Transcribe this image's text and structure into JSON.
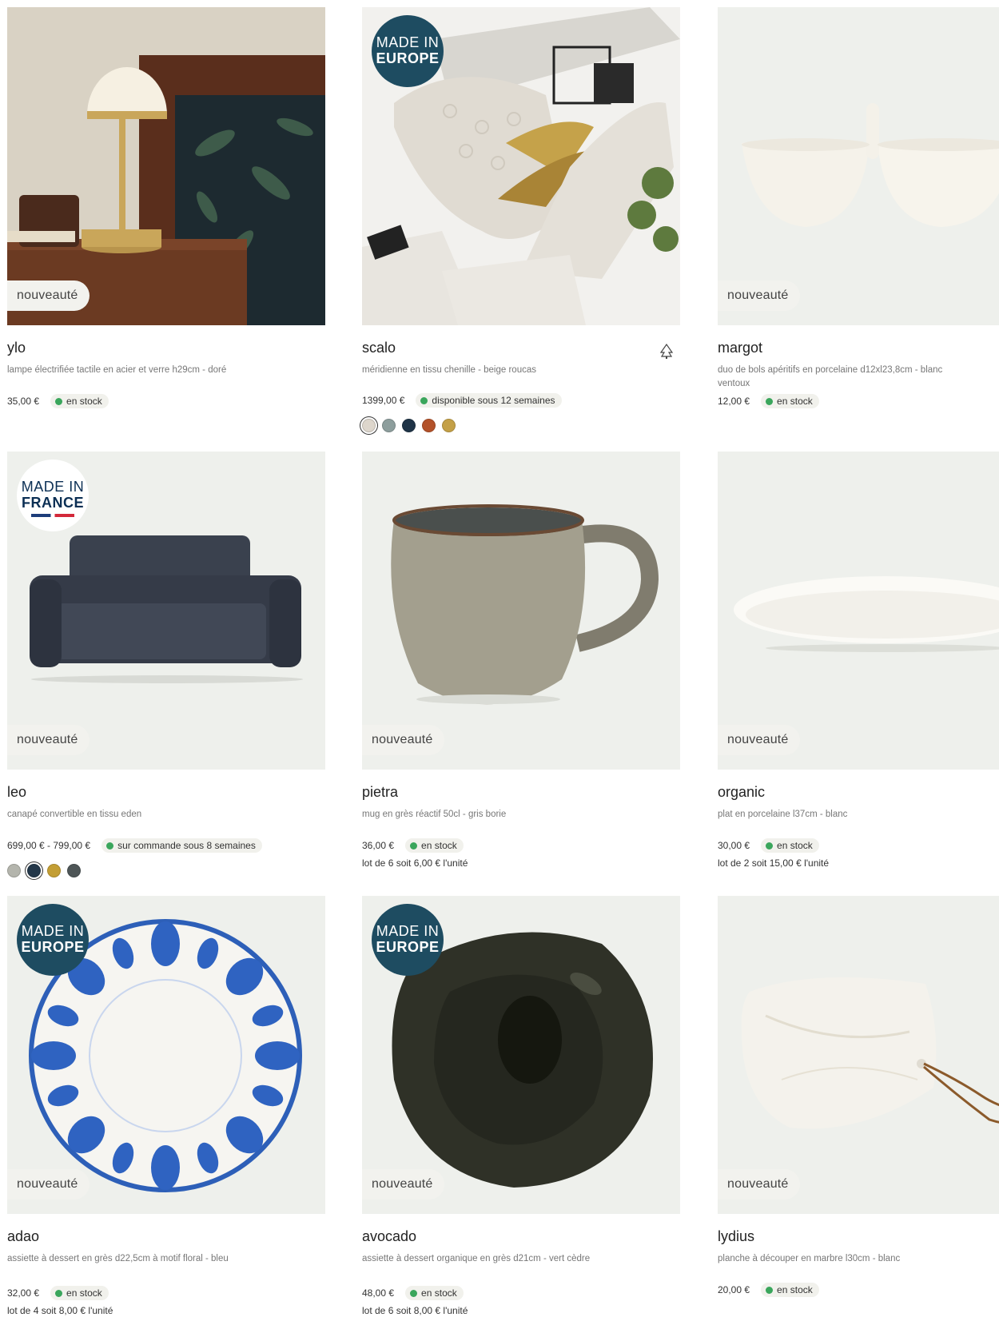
{
  "products": [
    {
      "name": "ylo",
      "desc": "lampe électrifiée tactile en acier et verre h29cm - doré",
      "price": "35,00 €",
      "stock": "en stock",
      "badge": "nouveauté"
    },
    {
      "name": "scalo",
      "desc": "méridienne en tissu chenille - beige roucas",
      "price": "1399,00 €",
      "stock": "disponible sous 12 semaines",
      "made_top": "MADE IN",
      "made_bottom": "EUROPE",
      "swatches": [
        "#ddd6cc",
        "#8d9e9d",
        "#1f3447",
        "#b3522a",
        "#c4a047"
      ]
    },
    {
      "name": "margot",
      "desc": "duo de bols apéritifs en porcelaine d12xl23,8cm - blanc ventoux",
      "price": "12,00 €",
      "stock": "en stock",
      "badge": "nouveauté"
    },
    {
      "name": "leo",
      "desc": "canapé convertible en tissu eden",
      "price": "699,00 € - 799,00 €",
      "stock": "sur commande sous 8 semaines",
      "badge": "nouveauté",
      "made_top": "MADE IN",
      "made_bottom": "FRANCE",
      "swatches": [
        "#b4b5ad",
        "#24384a",
        "#c39e34",
        "#4e5657"
      ]
    },
    {
      "name": "pietra",
      "desc": "mug en grès réactif 50cl - gris borie",
      "price": "36,00 €",
      "stock": "en stock",
      "lot": "lot de 6 soit 6,00 € l'unité",
      "badge": "nouveauté"
    },
    {
      "name": "organic",
      "desc": "plat en porcelaine l37cm - blanc",
      "price": "30,00 €",
      "stock": "en stock",
      "lot": "lot de 2 soit 15,00 € l'unité",
      "badge": "nouveauté"
    },
    {
      "name": "adao",
      "desc": "assiette à dessert en grès d22,5cm à motif floral - bleu",
      "price": "32,00 €",
      "stock": "en stock",
      "lot": "lot de 4 soit 8,00 € l'unité",
      "badge": "nouveauté",
      "made_top": "MADE IN",
      "made_bottom": "EUROPE"
    },
    {
      "name": "avocado",
      "desc": "assiette à dessert organique en grès d21cm - vert cèdre",
      "price": "48,00 €",
      "stock": "en stock",
      "lot": "lot de 6 soit 8,00 € l'unité",
      "badge": "nouveauté",
      "made_top": "MADE IN",
      "made_bottom": "EUROPE"
    },
    {
      "name": "lydius",
      "desc": "planche à découper en marbre l30cm - blanc",
      "price": "20,00 €",
      "stock": "en stock",
      "badge": "nouveauté"
    }
  ],
  "icons": {
    "fsc": "fsc-tree-icon",
    "stock": "green-dot-icon"
  },
  "colors": {
    "stock_dot": "#3aa65c",
    "made_badge": "#1e4c61",
    "image_bg": "#eef0ec"
  }
}
